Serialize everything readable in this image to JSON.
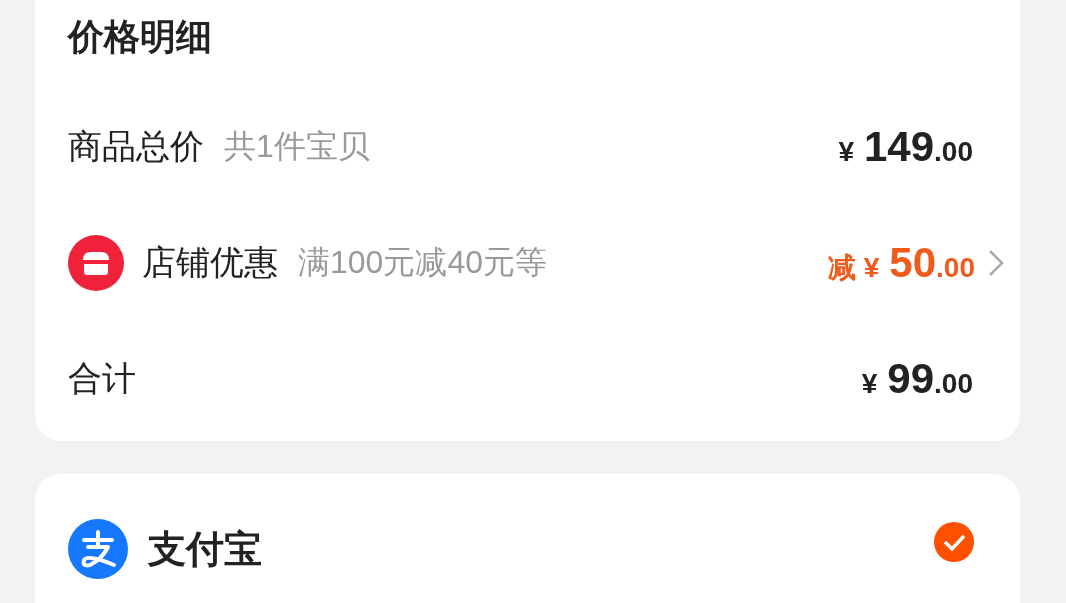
{
  "price_detail": {
    "title": "价格明细",
    "rows": [
      {
        "kind": "plain",
        "label": "商品总价",
        "note": "共1件宝贝",
        "currency": "¥",
        "integer": "149",
        "decimal": ".00"
      },
      {
        "kind": "discount",
        "label": "店铺优惠",
        "note": "满100元减40元等",
        "prefix": "减",
        "currency": "¥",
        "integer": "50",
        "decimal": ".00"
      },
      {
        "kind": "plain",
        "label": "合计",
        "currency": "¥",
        "integer": "99",
        "decimal": ".00"
      }
    ]
  },
  "payment": {
    "methods": [
      {
        "name": "支付宝",
        "selected": true
      }
    ]
  }
}
